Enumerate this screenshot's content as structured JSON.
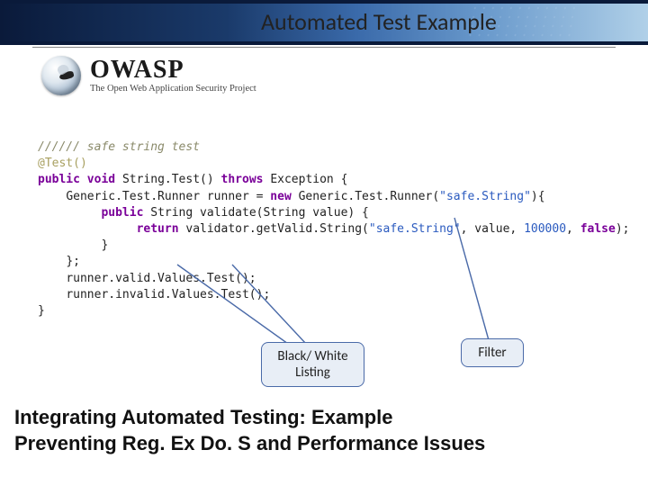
{
  "header": {
    "title": "Automated Test Example"
  },
  "logo": {
    "name": "OWASP",
    "tagline": "The Open Web Application Security Project"
  },
  "code": {
    "comment": "////// safe string test",
    "annotation": "@Test()",
    "l1_kw1": "public",
    "l1_kw2": "void",
    "l1_name": "String.Test()",
    "l1_kw3": "throws",
    "l1_exc": "Exception {",
    "l2_a": "Generic.Test.Runner runner =",
    "l2_kw": "new",
    "l2_b": "Generic.Test.Runner(",
    "l2_str": "\"safe.String\"",
    "l2_c": "){",
    "l3_kw1": "public",
    "l3_a": "String validate(String value) {",
    "l4_kw": "return",
    "l4_a": "validator.getValid.String(",
    "l4_str": "\"safe.String\"",
    "l4_b": ", value,",
    "l4_num": "100000",
    "l4_c": ",",
    "l4_bool": "false",
    "l4_d": ");",
    "l5": "}",
    "l6": "};",
    "l7": "runner.valid.Values.Test();",
    "l8": "runner.invalid.Values.Test();",
    "l9": "}"
  },
  "callouts": {
    "blackwhite": "Black/ White Listing",
    "filter": "Filter"
  },
  "footer": {
    "line1": "Integrating Automated Testing: Example",
    "line2": "Preventing Reg. Ex Do. S and Performance Issues"
  }
}
